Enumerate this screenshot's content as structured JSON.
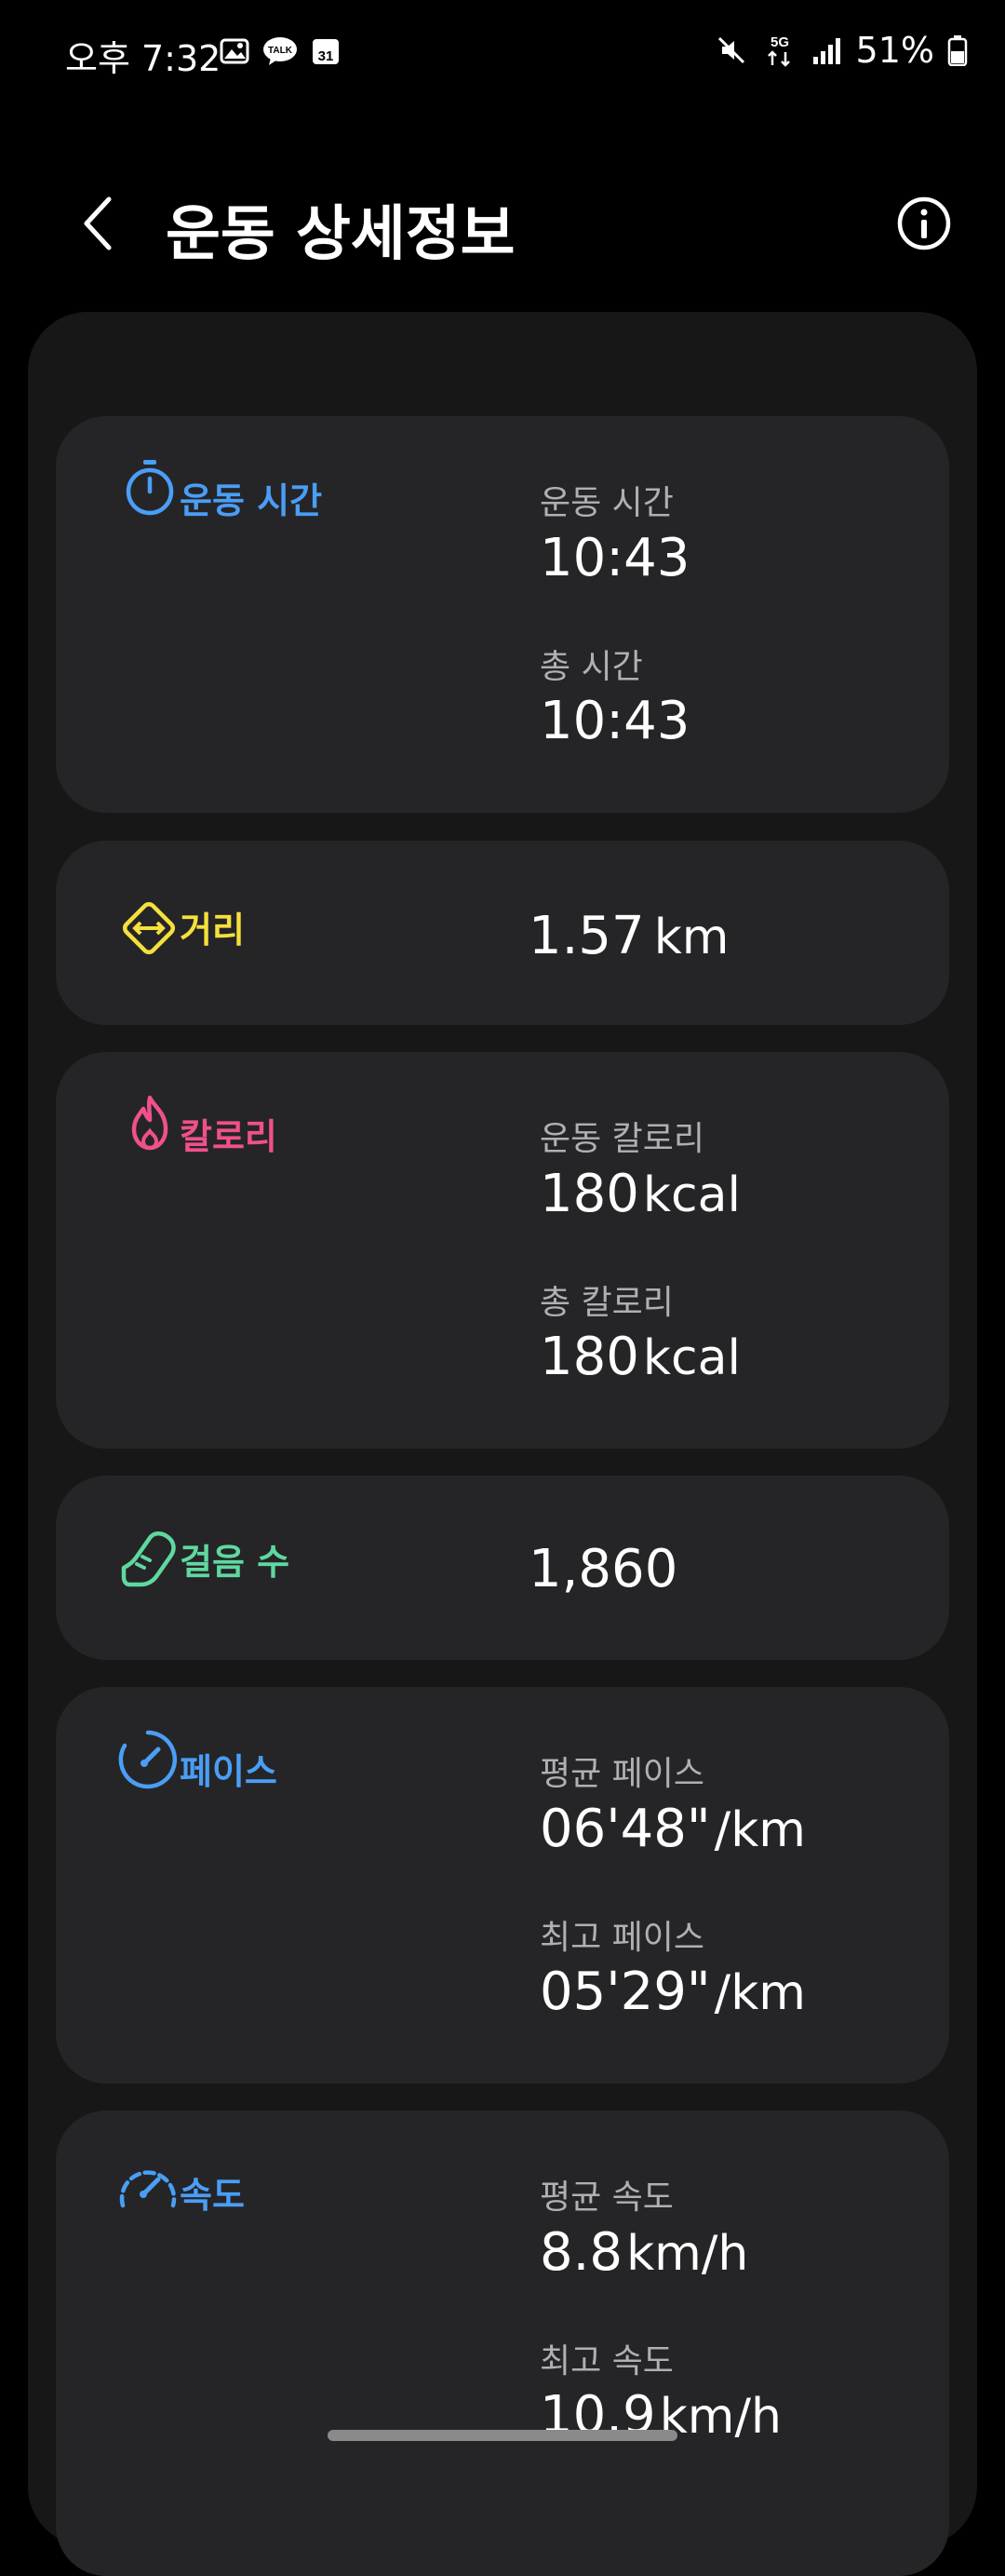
{
  "status_bar": {
    "time": "오후 7:32",
    "battery": "51%",
    "network": "5G"
  },
  "header": {
    "title": "운동 상세정보"
  },
  "colors": {
    "blue": "#4a9ef5",
    "yellow": "#f5e03c",
    "pink": "#f0508c",
    "green": "#5fd8a0"
  },
  "sections": {
    "time": {
      "label": "운동 시간",
      "icon": "stopwatch-icon",
      "items": [
        {
          "label": "운동 시간",
          "value": "10:43"
        },
        {
          "label": "총 시간",
          "value": "10:43"
        }
      ]
    },
    "distance": {
      "label": "거리",
      "icon": "distance-icon",
      "value": "1.57",
      "unit": "km"
    },
    "calories": {
      "label": "칼로리",
      "icon": "flame-icon",
      "items": [
        {
          "label": "운동 칼로리",
          "value": "180",
          "unit": "kcal"
        },
        {
          "label": "총 칼로리",
          "value": "180",
          "unit": "kcal"
        }
      ]
    },
    "steps": {
      "label": "걸음 수",
      "icon": "shoe-icon",
      "value": "1,860"
    },
    "pace": {
      "label": "페이스",
      "icon": "pace-gauge-icon",
      "items": [
        {
          "label": "평균 페이스",
          "value": "06'48\"",
          "unit": "/km"
        },
        {
          "label": "최고 페이스",
          "value": "05'29\"",
          "unit": "/km"
        }
      ]
    },
    "speed": {
      "label": "속도",
      "icon": "speedometer-icon",
      "items": [
        {
          "label": "평균 속도",
          "value": "8.8",
          "unit": "km/h"
        },
        {
          "label": "최고 속도",
          "value": "10.9",
          "unit": "km/h"
        }
      ]
    }
  }
}
